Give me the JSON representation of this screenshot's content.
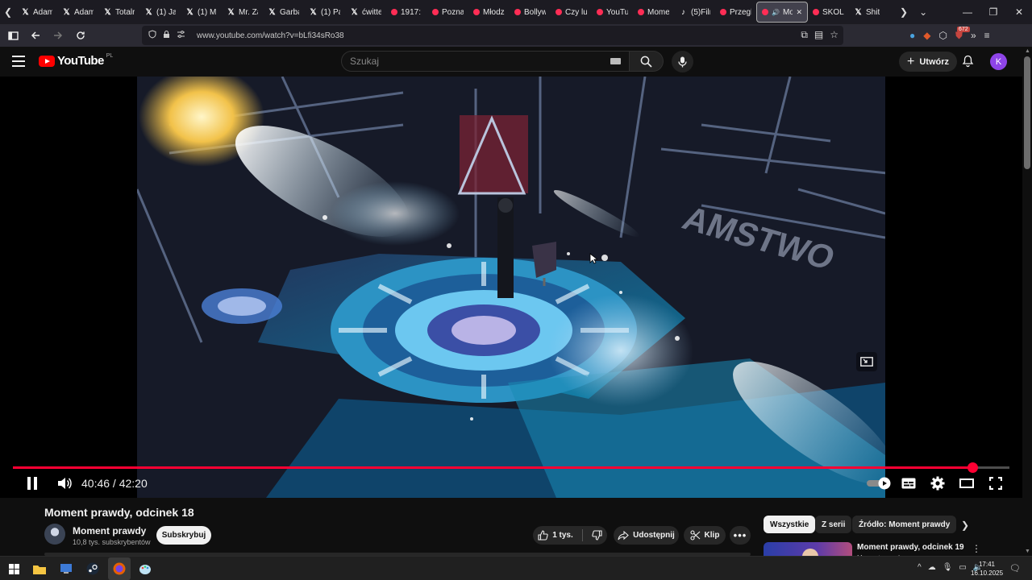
{
  "browser": {
    "tabs": [
      {
        "label": "Adam",
        "icon": "x-icon"
      },
      {
        "label": "Adam",
        "icon": "x-icon"
      },
      {
        "label": "Totalr",
        "icon": "x-icon"
      },
      {
        "label": "(1) Jac",
        "icon": "x-icon"
      },
      {
        "label": "(1) Mi",
        "icon": "x-icon"
      },
      {
        "label": "Mr. Ża",
        "icon": "x-icon"
      },
      {
        "label": "Garba",
        "icon": "x-icon"
      },
      {
        "label": "(1) Pa",
        "icon": "x-icon"
      },
      {
        "label": "ćwitte",
        "icon": "x-icon"
      },
      {
        "label": "1917:",
        "icon": "youtube-icon"
      },
      {
        "label": "Pozna",
        "icon": "youtube-icon"
      },
      {
        "label": "Młodz",
        "icon": "youtube-icon"
      },
      {
        "label": "Bollyw",
        "icon": "youtube-icon"
      },
      {
        "label": "Czy lu",
        "icon": "youtube-icon"
      },
      {
        "label": "YouTu",
        "icon": "youtube-icon"
      },
      {
        "label": "Mome",
        "icon": "youtube-icon"
      },
      {
        "label": "(5)Filn",
        "icon": "tiktok-icon"
      },
      {
        "label": "Przegl",
        "icon": "youtube-icon"
      },
      {
        "label": "Mo",
        "icon": "youtube-icon",
        "active": true
      },
      {
        "label": "SKOLI",
        "icon": "youtube-icon"
      },
      {
        "label": "Shit",
        "icon": "x-icon"
      }
    ],
    "url": "www.youtube.com/watch?v=bLfi34sRo38",
    "extension_badge": "672"
  },
  "youtube": {
    "logo_text": "YouTube",
    "country_code": "PL",
    "search_placeholder": "Szukaj",
    "create_label": "Utwórz",
    "avatar_letter": "K",
    "avatar_color": "#8e44e8"
  },
  "player": {
    "current_time": "40:46",
    "separator": " / ",
    "duration": "42:20",
    "progress_fraction": 0.963,
    "accent_color": "#ff0033"
  },
  "video_info": {
    "title": "Moment prawdy, odcinek 18",
    "channel_name": "Moment prawdy",
    "subscribers": "10,8 tys. subskrybentów",
    "subscribe_label": "Subskrybuj",
    "likes": "1 tys.",
    "share_label": "Udostępnij",
    "clip_label": "Klip"
  },
  "sidebar": {
    "chips": [
      "Wszystkie",
      "Z serii",
      "Źródło: Moment prawdy"
    ],
    "next_video_title": "Moment prawdy, odcinek 19",
    "next_video_channel": "Moment prawdy"
  },
  "taskbar": {
    "time": "17:41",
    "date": "16.10.2025"
  }
}
